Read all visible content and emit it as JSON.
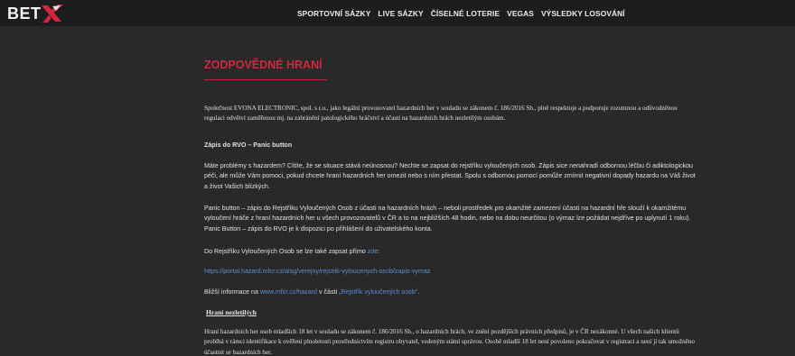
{
  "header": {
    "logo_text": "BET",
    "logo_letter": "X",
    "nav": [
      "SPORTOVNÍ SÁZKY",
      "LIVE SÁZKY",
      "ČÍSELNÉ LOTERIE",
      "VEGAS",
      "VÝSLEDKY LOSOVÁNÍ"
    ]
  },
  "main": {
    "title": "ZODPOVĚDNÉ HRANÍ",
    "intro": "Společnost EVONA ELECTRONIC, spol. s r.o., jako legální provozovatel hazardních her v souladu se zákonem č. 186/2016 Sb., plně respektuje a podporuje rozumnou a odůvodněnou regulaci odvětví zaměřenou mj. na zabránění patologického hráčství a účasti na hazardních hrách nezletilým osobám.",
    "rvo_heading": "Zápis do RVO – Panic button",
    "rvo_p1": "Máte problémy s hazardem? Cítíte, že se situace stává neúnosnou? Nechte se zapsat do rejstříku vyloučených osob. Zápis sice nenahradí odbornou léčbu či adiktologickou péči, ale může Vám pomoci, pokud chcete hraní hazardních her omezit nebo s ním přestat. Spolu s odbornou pomocí pomůže zmírnit negativní dopady hazardu na Váš život a život Vašich blízkých.",
    "rvo_p2": "Panic button – zápis do Rejstříku Vyloučených Osob z účasti na hazardních hrách – neboli prostředek pro okamžité zamezení účasti na hazardní hře slouží k okamžitému vyloučení hráče z hraní hazardních her u všech provozovatelů v ČR a to na nejbližších 48 hodin, nebo na dobu neurčitou (o výmaz lze požádat nejdříve po uplynutí 1 roku). Panic Button – zápis do RVO je k dispozici po přihlášení do uživatelského konta.",
    "direct_text": "Do Rejstříku Vyloučených Osob se lze také zapsat přímo ",
    "direct_link": "zde",
    "direct_end": ":",
    "url": "https://portal.hazard.mfcr.cz/aisg/verejny/rejstrik-vyloucenych-osob/zapis-vymaz",
    "more_pre": "Bližší informace na ",
    "more_link": "www.mfcr.cz/hazard",
    "more_mid": " v části ",
    "more_link2": "„Rejstřík vyloučených osob“",
    "more_end": ".",
    "minors_heading": "Hraní nezletilých",
    "minors_p": "Hraní hazardních her osob mladších 18 let v souladu se zákonem č. 186/2016 Sb., o hazardních hrách, ve znění pozdějších právních předpisů, je v ČR nezákonné. U všech našich klientů probíhá v rámci identifikace k ověření plnoletosti prostřednictvím registru obyvatel, vedeným státní správou. Osobě mladší 18 let není povoleno pokračovat v registraci a není jí tak umožněno účastnit se hazardních her."
  },
  "colors": {
    "accent": "#d4253f",
    "link": "#5b8fd6",
    "background": "#292929",
    "header_bg": "#1d1d1d"
  }
}
